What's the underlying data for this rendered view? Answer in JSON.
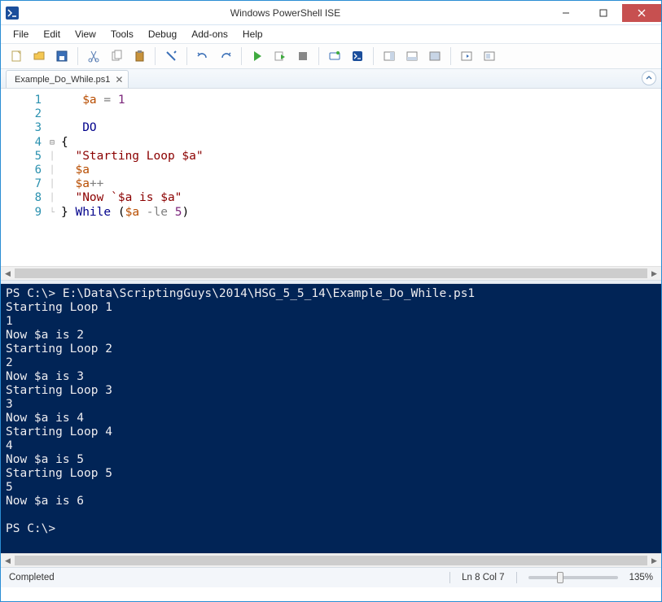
{
  "window": {
    "title": "Windows PowerShell ISE"
  },
  "menu": {
    "items": [
      "File",
      "Edit",
      "View",
      "Tools",
      "Debug",
      "Add-ons",
      "Help"
    ]
  },
  "tab": {
    "name": "Example_Do_While.ps1"
  },
  "code": {
    "lines": [
      {
        "n": 1,
        "indent": "   ",
        "tokens": [
          [
            "t-var",
            "$a"
          ],
          [
            "",
            " "
          ],
          [
            "t-op",
            "="
          ],
          [
            "",
            " "
          ],
          [
            "t-num",
            "1"
          ]
        ]
      },
      {
        "n": 2,
        "indent": "",
        "tokens": []
      },
      {
        "n": 3,
        "indent": "   ",
        "tokens": [
          [
            "t-kw",
            "DO"
          ]
        ]
      },
      {
        "n": 4,
        "indent": "",
        "fold": "⊟",
        "tokens": [
          [
            "",
            "{"
          ]
        ]
      },
      {
        "n": 5,
        "indent": "  ",
        "pipe": true,
        "tokens": [
          [
            "t-str",
            "\"Starting Loop $a\""
          ]
        ]
      },
      {
        "n": 6,
        "indent": "  ",
        "pipe": true,
        "tokens": [
          [
            "t-var",
            "$a"
          ]
        ]
      },
      {
        "n": 7,
        "indent": "  ",
        "pipe": true,
        "tokens": [
          [
            "t-var",
            "$a"
          ],
          [
            "t-op",
            "++"
          ]
        ]
      },
      {
        "n": 8,
        "indent": "  ",
        "pipe": true,
        "tokens": [
          [
            "t-str",
            "\"Now `$a is $a\""
          ]
        ]
      },
      {
        "n": 9,
        "indent": "",
        "end": true,
        "tokens": [
          [
            "",
            "} "
          ],
          [
            "t-kw",
            "While"
          ],
          [
            "",
            " ("
          ],
          [
            "t-var",
            "$a"
          ],
          [
            "",
            " "
          ],
          [
            "t-op",
            "-le"
          ],
          [
            "",
            " "
          ],
          [
            "t-num",
            "5"
          ],
          [
            "",
            ")"
          ]
        ]
      }
    ]
  },
  "console": {
    "lines": [
      "PS C:\\> E:\\Data\\ScriptingGuys\\2014\\HSG_5_5_14\\Example_Do_While.ps1",
      "Starting Loop 1",
      "1",
      "Now $a is 2",
      "Starting Loop 2",
      "2",
      "Now $a is 3",
      "Starting Loop 3",
      "3",
      "Now $a is 4",
      "Starting Loop 4",
      "4",
      "Now $a is 5",
      "Starting Loop 5",
      "5",
      "Now $a is 6",
      "",
      "PS C:\\> "
    ]
  },
  "status": {
    "left": "Completed",
    "pos": "Ln 8  Col 7",
    "zoom": "135%"
  },
  "icons": {
    "toolbar": [
      "new",
      "open",
      "save",
      "cut",
      "copy",
      "paste",
      "clear",
      "undo",
      "redo",
      "run",
      "run-selection",
      "stop",
      "remote",
      "launch-shell",
      "layout-right",
      "layout-bottom",
      "layout-full",
      "show-command",
      "options"
    ]
  }
}
